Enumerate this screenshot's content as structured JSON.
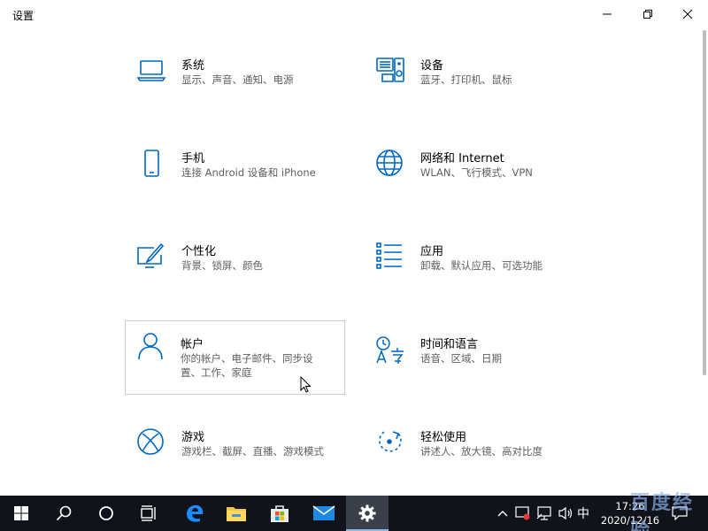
{
  "window": {
    "title": "设置"
  },
  "tiles": [
    {
      "name": "系统",
      "desc": "显示、声音、通知、电源"
    },
    {
      "name": "设备",
      "desc": "蓝牙、打印机、鼠标"
    },
    {
      "name": "手机",
      "desc": "连接 Android 设备和 iPhone"
    },
    {
      "name": "网络和 Internet",
      "desc": "WLAN、飞行模式、VPN"
    },
    {
      "name": "个性化",
      "desc": "背景、锁屏、颜色"
    },
    {
      "name": "应用",
      "desc": "卸载、默认应用、可选功能"
    },
    {
      "name": "帐户",
      "desc": "你的帐户、电子邮件、同步设置、工作、家庭"
    },
    {
      "name": "时间和语言",
      "desc": "语音、区域、日期"
    },
    {
      "name": "游戏",
      "desc": "游戏栏、截屏、直播、游戏模式"
    },
    {
      "name": "轻松使用",
      "desc": "讲述人、放大镜、高对比度"
    }
  ],
  "taskbar": {
    "ime": "中",
    "time": "17:26",
    "date": "2020/12/16",
    "active_app": "settings"
  },
  "watermark": "百度经验",
  "colors": {
    "accent": "#0067c0",
    "taskbar": "#10131a"
  }
}
